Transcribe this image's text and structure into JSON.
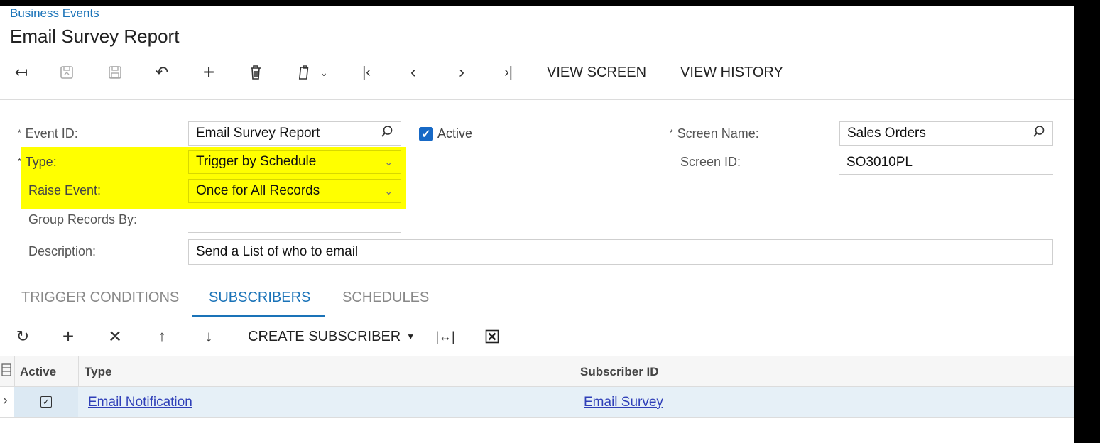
{
  "header": {
    "breadcrumb": "Business Events",
    "title": "Email Survey Report"
  },
  "toolbar": {
    "view_screen": "VIEW SCREEN",
    "view_history": "VIEW HISTORY"
  },
  "form": {
    "event_id_label": "Event ID:",
    "event_id_value": "Email Survey Report",
    "active_label": "Active",
    "type_label": "Type:",
    "type_value": "Trigger by Schedule",
    "raise_event_label": "Raise Event:",
    "raise_event_value": "Once for All Records",
    "group_records_label": "Group Records By:",
    "group_records_value": "",
    "description_label": "Description:",
    "description_value": "Send a List of who to email",
    "screen_name_label": "Screen Name:",
    "screen_name_value": "Sales Orders",
    "screen_id_label": "Screen ID:",
    "screen_id_value": "SO3010PL",
    "required_marker": "*"
  },
  "tabs": {
    "trigger_conditions": "TRIGGER CONDITIONS",
    "subscribers": "SUBSCRIBERS",
    "schedules": "SCHEDULES"
  },
  "grid": {
    "toolbar": {
      "create_subscriber": "CREATE SUBSCRIBER"
    },
    "columns": {
      "active": "Active",
      "type": "Type",
      "subscriber_id": "Subscriber ID"
    },
    "rows": [
      {
        "active": true,
        "type": "Email Notification",
        "subscriber_id": "Email Survey"
      }
    ]
  },
  "colors": {
    "highlight": "#ffff00",
    "link": "#2f3fb8",
    "accent": "#1a73b8"
  }
}
